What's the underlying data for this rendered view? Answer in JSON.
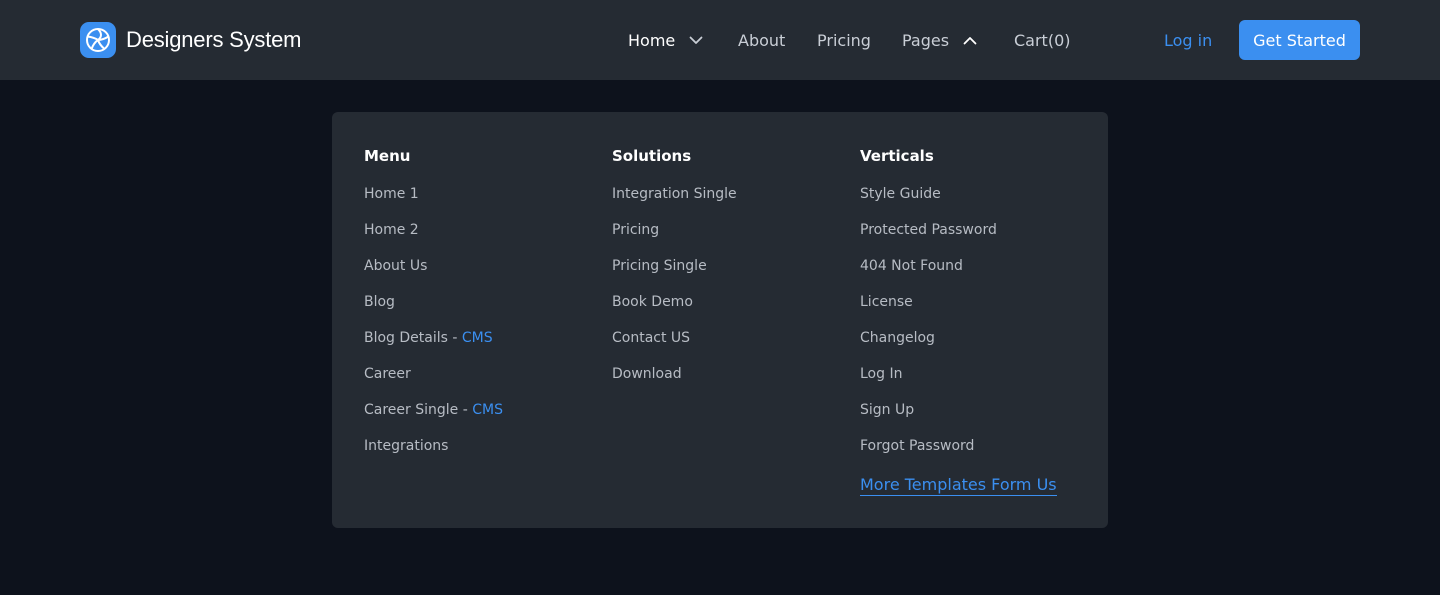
{
  "brand": {
    "name": "Designers System",
    "accent": "#3b8ff0",
    "icon": "aperture-icon"
  },
  "nav": {
    "home": "Home",
    "about": "About",
    "pricing": "Pricing",
    "pages": "Pages",
    "cart": "Cart(0)"
  },
  "auth": {
    "login": "Log in",
    "get_started": "Get Started"
  },
  "dropdown": {
    "menu": {
      "heading": "Menu",
      "items": [
        "Home 1",
        "Home 2",
        "About Us",
        "Blog",
        "Blog Details",
        "Career",
        "Career Single",
        "Integrations"
      ],
      "badges": [
        "",
        "",
        "",
        "",
        "CMS",
        "",
        "CMS",
        ""
      ],
      "separator": " - "
    },
    "solutions": {
      "heading": "Solutions",
      "items": [
        "Integration Single",
        "Pricing",
        "Pricing Single",
        "Book Demo",
        "Contact US",
        "Download"
      ]
    },
    "verticals": {
      "heading": "Verticals",
      "items": [
        "Style Guide",
        "Protected Password",
        "404 Not Found",
        "License",
        "Changelog",
        "Log In",
        "Sign Up",
        "Forgot Password"
      ],
      "more_link": "More Templates Form Us"
    }
  }
}
